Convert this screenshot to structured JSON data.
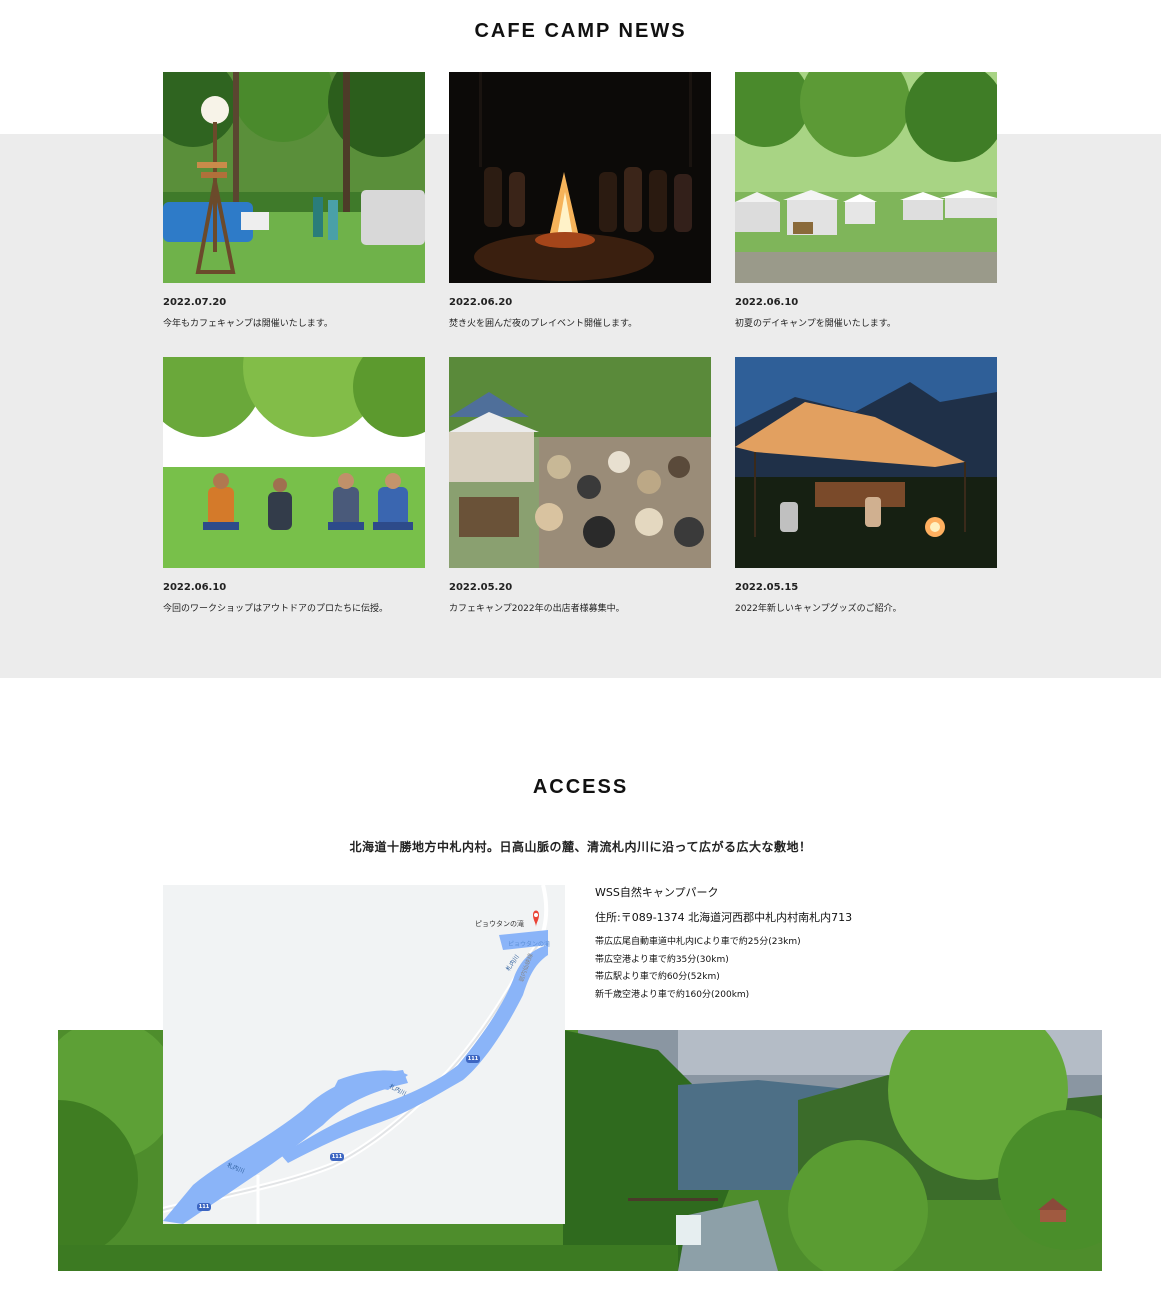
{
  "news": {
    "title": "CAFE CAMP NEWS",
    "items": [
      {
        "date": "2022.07.20",
        "text": "今年もカフェキャンプは開催いたします。",
        "image": "jeep-campsite-photo"
      },
      {
        "date": "2022.06.20",
        "text": "焚き火を囲んだ夜のプレイベント開催します。",
        "image": "night-bonfire-photo"
      },
      {
        "date": "2022.06.10",
        "text": "初夏のデイキャンプを開催いたします。",
        "image": "tent-market-photo"
      },
      {
        "date": "2022.06.10",
        "text": "今回のワークショップはアウトドアのプロたちに伝授。",
        "image": "people-in-chairs-photo"
      },
      {
        "date": "2022.05.20",
        "text": "カフェキャンプ2022年の出店者様募集中。",
        "image": "crowd-market-photo"
      },
      {
        "date": "2022.05.15",
        "text": "2022年新しいキャンプグッズのご紹介。",
        "image": "evening-tarp-photo"
      }
    ]
  },
  "access": {
    "title": "ACCESS",
    "lead": "北海道十勝地方中札内村。日高山脈の麓、清流札内川に沿って広がる広大な敷地！",
    "map": {
      "pin_label": "ピョウタンの滝",
      "lake_label": "ピョウタンの滝",
      "river_label": "札内川",
      "road_label": "岩内仙峡線",
      "route_number": "111"
    },
    "info": {
      "name": "WSS自然キャンプパーク",
      "address": "住所:〒089-1374 北海道河西郡中札内村南札内713",
      "routes": [
        "帯広広尾自動車道中札内ICより車で約25分(23km)",
        "帯広空港より車で約35分(30km)",
        "帯広駅より車で約60分(52km)",
        "新千歳空港より車で約160分(200km)"
      ]
    }
  },
  "colors": {
    "band": "#ececec",
    "river": "#8ab4f8",
    "pin": "#ea4335",
    "route_badge": "#3d66c2"
  }
}
